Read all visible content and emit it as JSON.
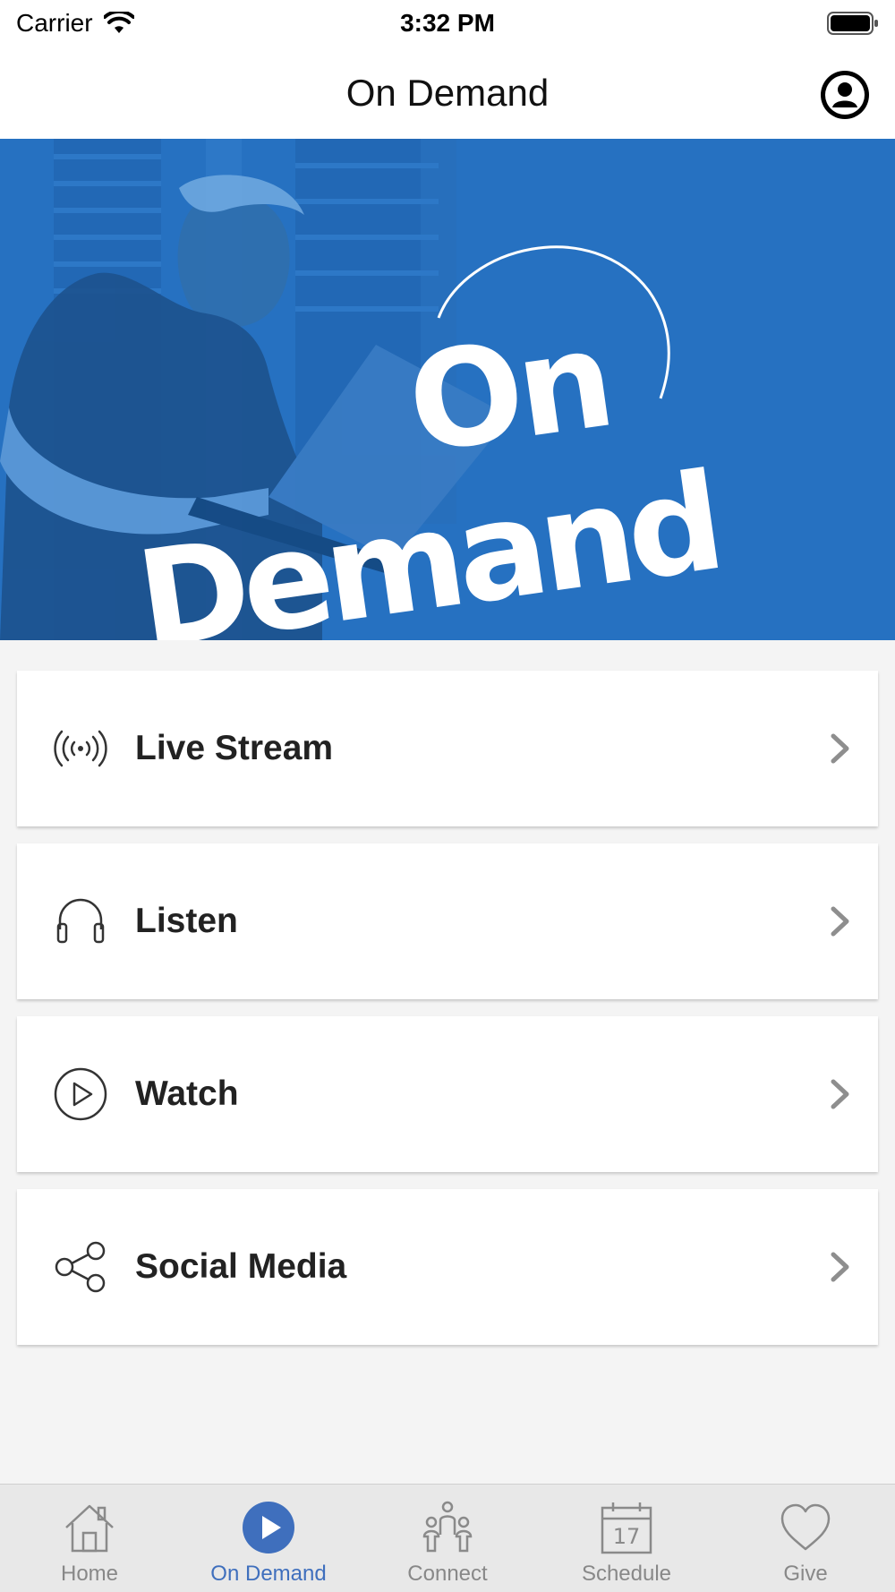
{
  "status_bar": {
    "carrier": "Carrier",
    "time": "3:32 PM"
  },
  "nav": {
    "title": "On Demand",
    "profile_icon": "person-circle-icon"
  },
  "banner": {
    "line1": "On",
    "line2": "Demand",
    "bg_color": "#2671c1"
  },
  "menu": {
    "items": [
      {
        "label": "Live Stream",
        "icon": "broadcast-icon"
      },
      {
        "label": "Listen",
        "icon": "headphones-icon"
      },
      {
        "label": "Watch",
        "icon": "play-circle-icon"
      },
      {
        "label": "Social Media",
        "icon": "share-icon"
      }
    ]
  },
  "tabs": {
    "items": [
      {
        "label": "Home",
        "icon": "home-icon"
      },
      {
        "label": "On Demand",
        "icon": "play-icon",
        "active": true
      },
      {
        "label": "Connect",
        "icon": "people-icon"
      },
      {
        "label": "Schedule",
        "icon": "calendar-icon"
      },
      {
        "label": "Give",
        "icon": "heart-icon"
      }
    ],
    "active_color": "#3f6fbd",
    "inactive_color": "#888888"
  }
}
